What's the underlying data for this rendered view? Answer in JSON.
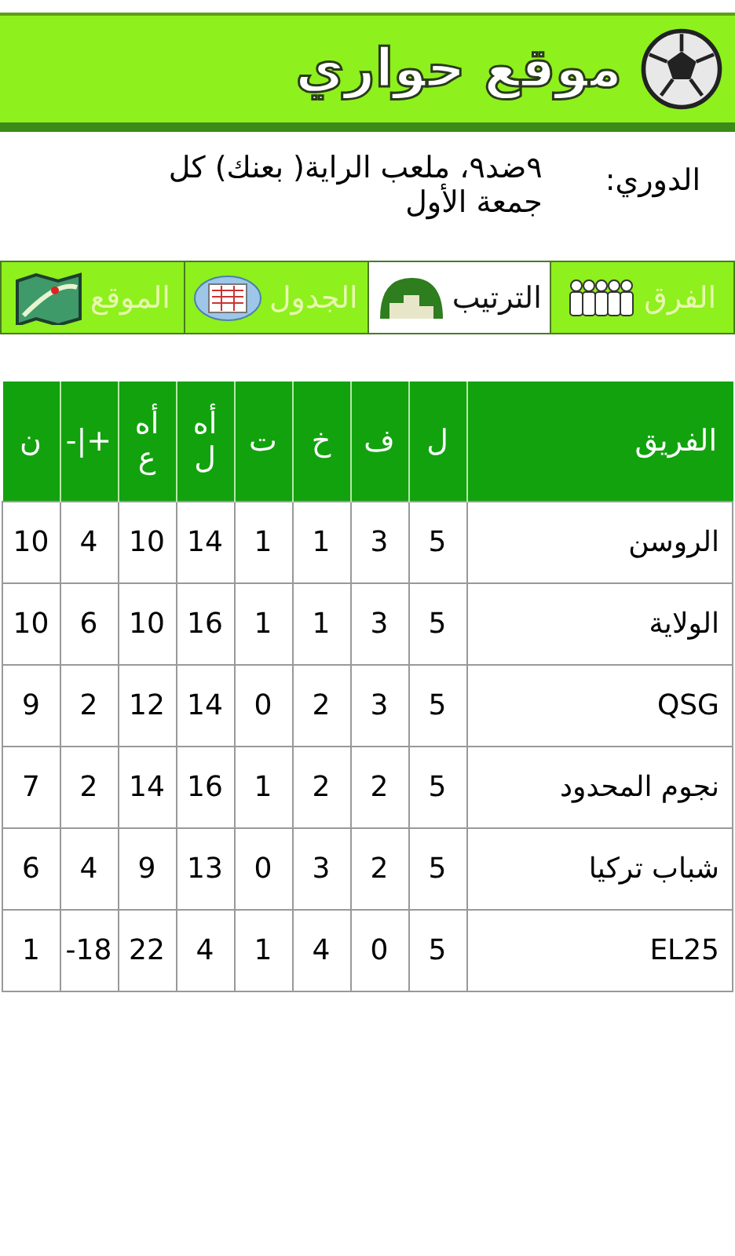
{
  "header": {
    "title": "موقع حواري"
  },
  "league": {
    "label": "الدوري:",
    "value": "٩ضد٩، ملعب الراية( بعنك) كل جمعة الأول"
  },
  "tabs": [
    {
      "label": "الفرق",
      "kind": "teams",
      "selected": false
    },
    {
      "label": "الترتيب",
      "kind": "standings",
      "selected": true
    },
    {
      "label": "الجدول",
      "kind": "schedule",
      "selected": false
    },
    {
      "label": "الموقع",
      "kind": "map",
      "selected": false
    }
  ],
  "table": {
    "columns": [
      "الفريق",
      "ل",
      "ف",
      "خ",
      "ت",
      "أه ل",
      "أه ع",
      "+|-",
      "ن"
    ],
    "rows": [
      [
        "الروسن",
        "5",
        "3",
        "1",
        "1",
        "14",
        "10",
        "4",
        "10"
      ],
      [
        "الولاية",
        "5",
        "3",
        "1",
        "1",
        "16",
        "10",
        "6",
        "10"
      ],
      [
        "QSG",
        "5",
        "3",
        "2",
        "0",
        "14",
        "12",
        "2",
        "9"
      ],
      [
        "نجوم المحدود",
        "5",
        "2",
        "2",
        "1",
        "16",
        "14",
        "2",
        "7"
      ],
      [
        "شباب تركيا",
        "5",
        "2",
        "3",
        "0",
        "13",
        "9",
        "4",
        "6"
      ],
      [
        "EL25",
        "5",
        "0",
        "4",
        "1",
        "4",
        "22",
        "-18",
        "1"
      ]
    ]
  }
}
